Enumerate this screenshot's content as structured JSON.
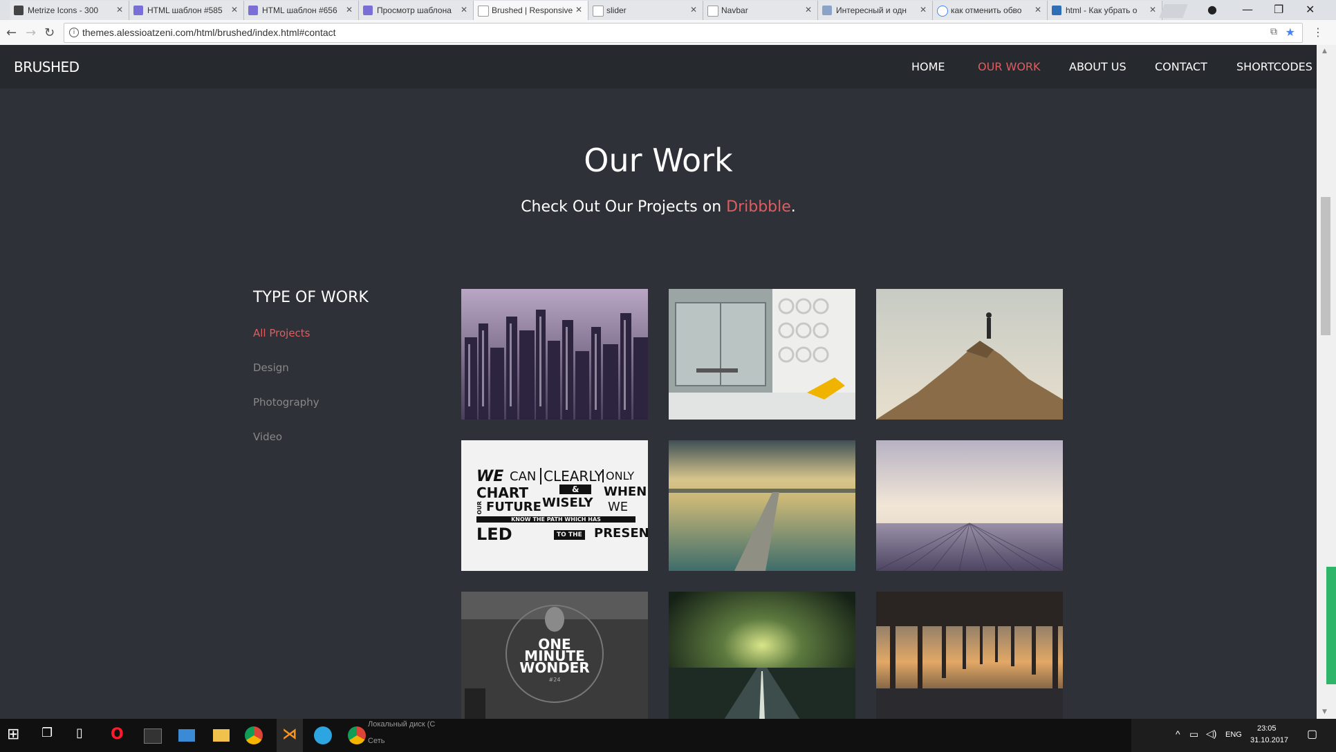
{
  "browser": {
    "tabs": [
      {
        "title": "Metrize Icons - 300",
        "active": false
      },
      {
        "title": "HTML шаблон #585",
        "active": false
      },
      {
        "title": "HTML шаблон #656",
        "active": false
      },
      {
        "title": "Просмотр шаблона",
        "active": false
      },
      {
        "title": "Brushed | Responsive",
        "active": true
      },
      {
        "title": "slider",
        "active": false
      },
      {
        "title": "Navbar",
        "active": false
      },
      {
        "title": "Интересный и одн",
        "active": false
      },
      {
        "title": "как отменить обво",
        "active": false
      },
      {
        "title": "html - Как убрать о",
        "active": false
      }
    ],
    "url": "themes.alessioatzeni.com/html/brushed/index.html#contact"
  },
  "site": {
    "brand": "BRUSHED",
    "nav": [
      "HOME",
      "OUR WORK",
      "ABOUT US",
      "CONTACT",
      "SHORTCODES"
    ],
    "active_nav": "OUR WORK",
    "accent_color": "#de5e60"
  },
  "section": {
    "title": "Our Work",
    "subtitle_prefix": "Check Out Our Projects on ",
    "subtitle_link": "Dribbble",
    "subtitle_suffix": "."
  },
  "filters": {
    "heading": "TYPE OF WORK",
    "items": [
      "All Projects",
      "Design",
      "Photography",
      "Video"
    ],
    "active": "All Projects"
  },
  "portfolio": {
    "items": [
      {
        "subject": "city skyline"
      },
      {
        "subject": "office interior"
      },
      {
        "subject": "hiker on mountain"
      },
      {
        "subject": "typography poster",
        "lines": [
          "WE",
          "CAN",
          "CHART",
          "OUR",
          "FUTURE",
          "CLEARLY",
          "&",
          "WISELY",
          "ONLY",
          "WHEN",
          "WE",
          "KNOW THE PATH WHICH HAS",
          "LED",
          "TO THE",
          "PRESENT"
        ]
      },
      {
        "subject": "pier at sunset"
      },
      {
        "subject": "wooden deck sky"
      },
      {
        "subject": "one minute wonder",
        "lines": [
          "ONE",
          "MINUTE",
          "WONDER",
          "#24"
        ]
      },
      {
        "subject": "stormy road"
      },
      {
        "subject": "pier underside beach"
      }
    ]
  },
  "taskbar": {
    "behind_window_text": [
      "Локальный диск (С",
      "Сеть"
    ],
    "tray": {
      "lang": "ENG",
      "time": "23:05",
      "date": "31.10.2017"
    }
  }
}
